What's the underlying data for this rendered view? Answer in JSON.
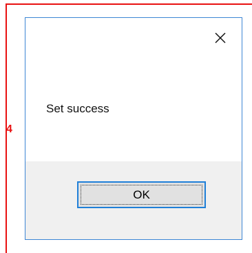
{
  "marker": {
    "label": "4"
  },
  "dialog": {
    "message": "Set success",
    "close_icon": "close-icon",
    "ok_label": "OK"
  },
  "colors": {
    "accent_border": "#3c85d4",
    "annotation_red": "#e81010",
    "footer_bg": "#f0f0f0",
    "button_bg": "#e1e1e1"
  }
}
